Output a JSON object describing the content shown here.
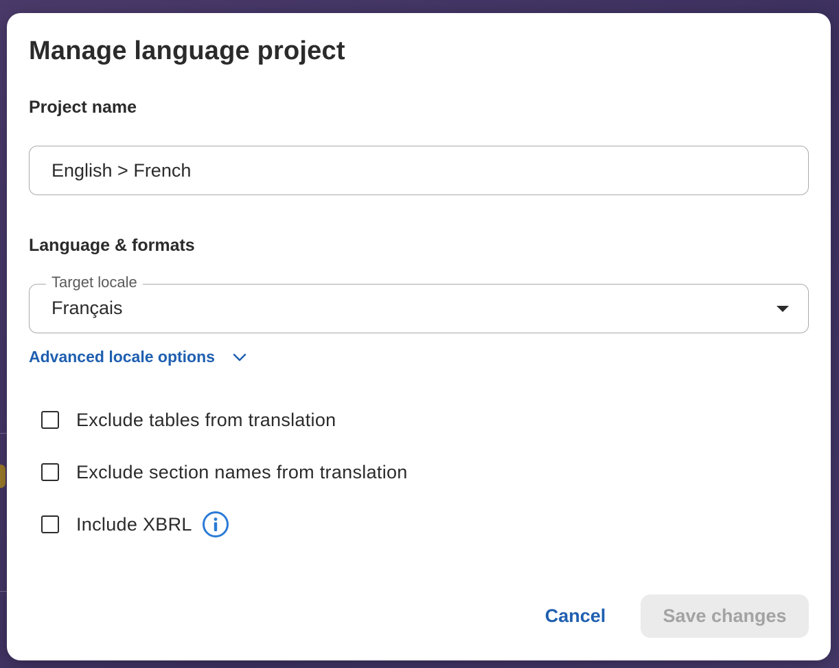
{
  "dialog": {
    "title": "Manage language project"
  },
  "project_name": {
    "label": "Project name",
    "value": "English > French"
  },
  "language_formats": {
    "label": "Language & formats",
    "target_locale": {
      "legend": "Target locale",
      "selected": "Français"
    },
    "advanced_link": "Advanced locale options"
  },
  "options": [
    {
      "label": "Exclude tables from translation",
      "checked": false
    },
    {
      "label": "Exclude section names from translation",
      "checked": false
    },
    {
      "label": "Include XBRL",
      "checked": false,
      "icon": "info-icon"
    }
  ],
  "buttons": {
    "cancel": "Cancel",
    "save": "Save changes",
    "save_disabled": true
  },
  "colors": {
    "accent": "#1f5fb0",
    "info_icon": "#2a7ad5",
    "text": "#2b2b2b",
    "disabled_bg": "#ebebeb",
    "disabled_text": "#a3a3a3"
  }
}
